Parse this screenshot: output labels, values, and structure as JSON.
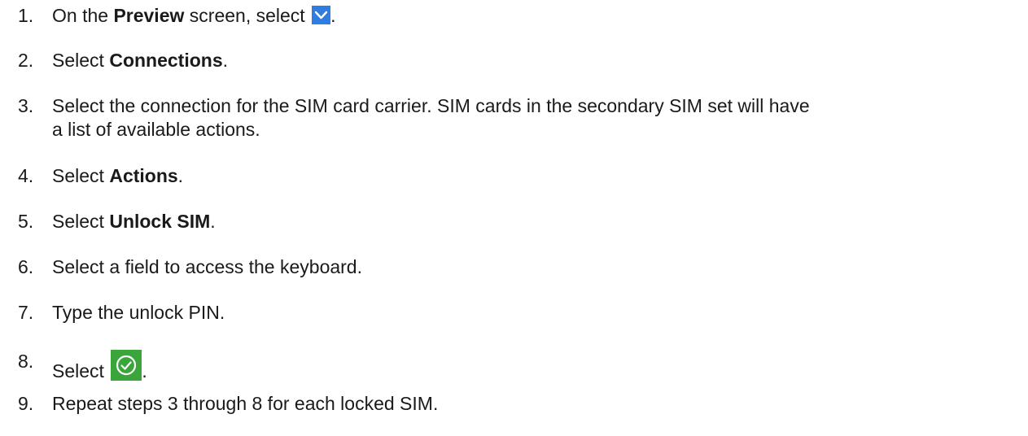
{
  "steps": [
    {
      "num": "1.",
      "pre": "On the ",
      "bold": "Preview",
      "post": " screen, select ",
      "end": ".",
      "icon": "chevron-down-icon"
    },
    {
      "num": "2.",
      "pre": "Select ",
      "bold": "Connections",
      "end": "."
    },
    {
      "num": "3.",
      "line1": "Select the connection for the SIM card carrier. SIM cards in the secondary SIM set will have",
      "line2": "a list of available actions."
    },
    {
      "num": "4.",
      "pre": "Select ",
      "bold": "Actions",
      "end": "."
    },
    {
      "num": "5.",
      "pre": "Select ",
      "bold": "Unlock SIM",
      "end": "."
    },
    {
      "num": "6.",
      "text": "Select a field to access the keyboard."
    },
    {
      "num": "7.",
      "text": "Type the unlock PIN."
    },
    {
      "num": "8.",
      "pre": "Select ",
      "end": ".",
      "icon": "check-circle-icon"
    },
    {
      "num": "9.",
      "text": "Repeat steps 3 through 8 for each locked SIM."
    }
  ],
  "colors": {
    "chevron_bg": "#2f7de1",
    "check_bg": "#3aa53a",
    "text": "#1a1a1a"
  }
}
